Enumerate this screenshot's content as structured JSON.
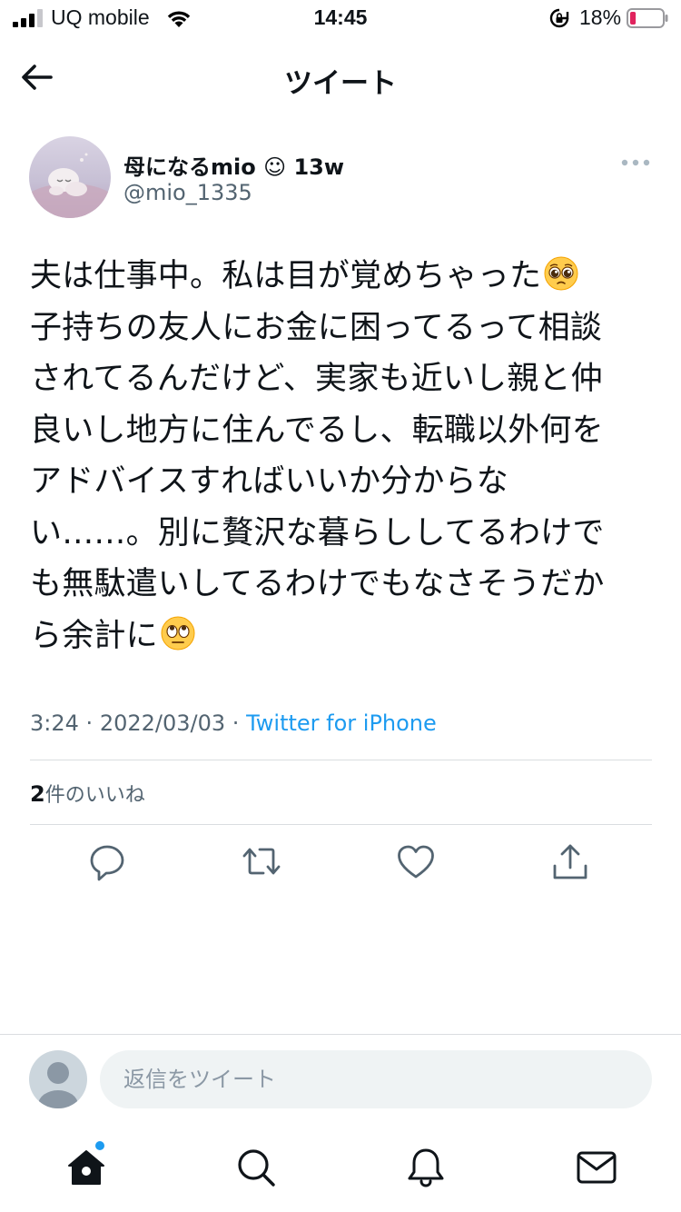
{
  "status_bar": {
    "carrier": "UQ mobile",
    "time": "14:45",
    "battery_percent": "18%",
    "battery_level": 0.18,
    "icons": [
      "signal-icon",
      "wifi-icon",
      "rotation-lock-icon",
      "battery-icon"
    ]
  },
  "header": {
    "title": "ツイート",
    "back_icon": "back-arrow-icon"
  },
  "tweet": {
    "author": {
      "display_name": "母になるmio ☺︎ 13w",
      "handle": "@mio_1335"
    },
    "text_lines": [
      "夫は仕事中。私は目が覚めちゃった",
      "子持ちの友人にお金に困ってるって相談",
      "されてるんだけど、実家も近いし親と仲",
      "良いし地方に住んでるし、転職以外何を",
      "アドバイスすればいいか分からな",
      "い……。別に贅沢な暮らししてるわけで",
      "も無駄遣いしてるわけでもなさそうだか",
      "ら余計に"
    ],
    "emojis": [
      "pleading-face-emoji",
      "face-with-rolling-eyes-emoji"
    ],
    "time": "3:24",
    "date": "2022/03/03",
    "separator": "·",
    "source": "Twitter for iPhone",
    "likes_count": "2",
    "likes_label": "件のいいね"
  },
  "actions": [
    "reply-icon",
    "retweet-icon",
    "like-icon",
    "share-icon"
  ],
  "reply": {
    "placeholder": "返信をツイート"
  },
  "tabbar": [
    "home-icon",
    "search-icon",
    "notifications-icon",
    "messages-icon"
  ],
  "colors": {
    "text": "#0f1419",
    "secondary": "#536471",
    "accent": "#1d9bf0",
    "divider": "#dadde0",
    "battery_low": "#e0245e"
  }
}
